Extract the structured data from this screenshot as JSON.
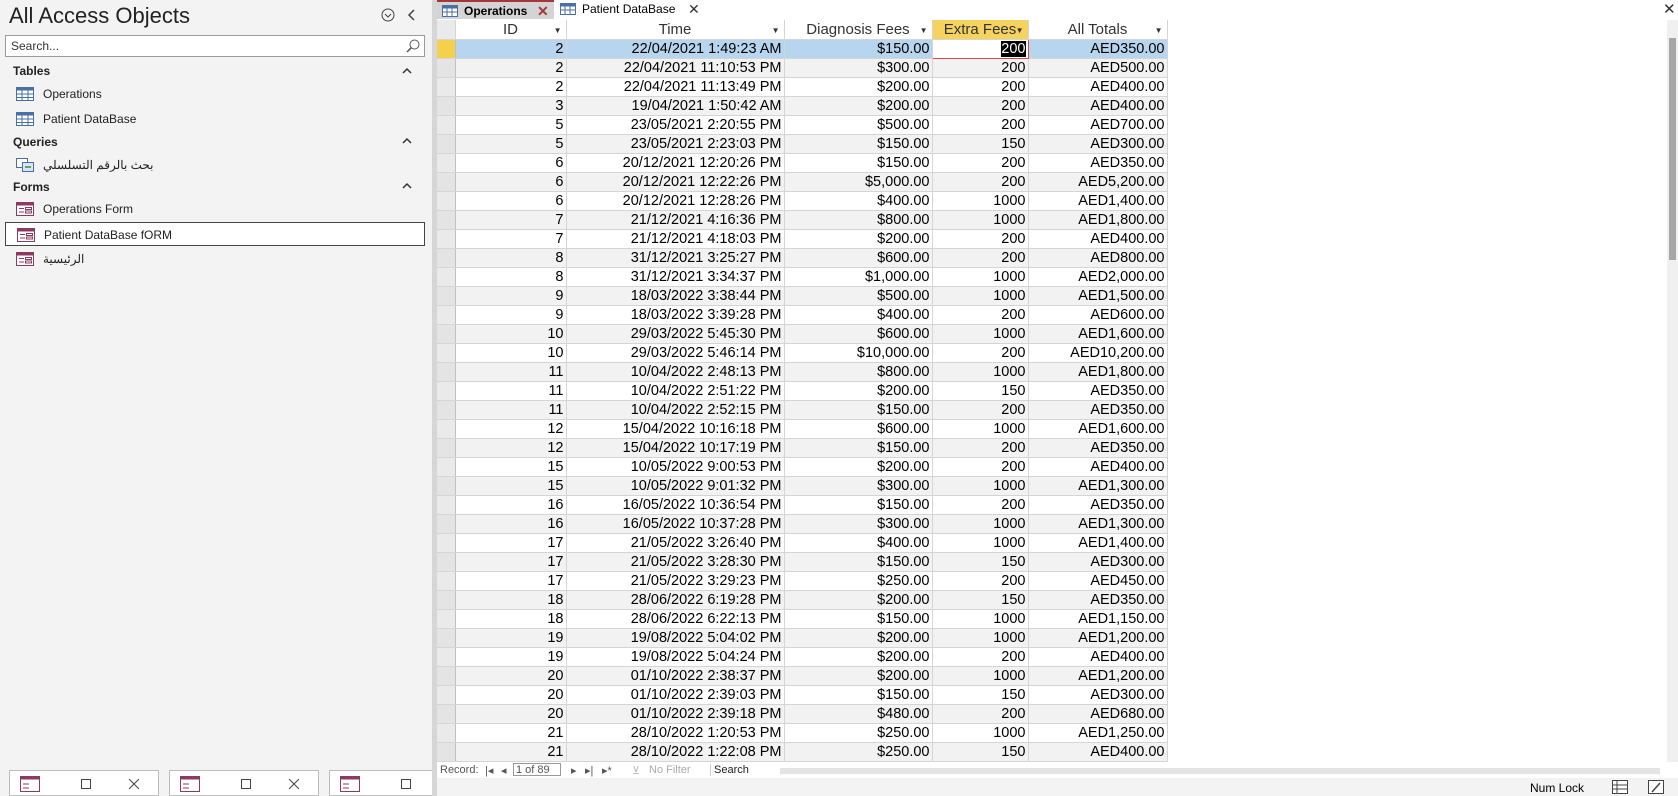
{
  "nav": {
    "title": "All Access Objects",
    "search_placeholder": "Search...",
    "groups": [
      {
        "label": "Tables",
        "items": [
          "Operations",
          "Patient DataBase"
        ]
      },
      {
        "label": "Queries",
        "items": [
          "بحث بالرقم التسلسلي"
        ]
      },
      {
        "label": "Forms",
        "items": [
          "Operations Form",
          "Patient DataBase fORM",
          "الرئيسية"
        ]
      }
    ]
  },
  "tabs": [
    {
      "label": "Operations",
      "active": true
    },
    {
      "label": "Patient DataBase",
      "active": false
    }
  ],
  "columns": [
    "ID",
    "Time",
    "Diagnosis Fees",
    "Extra Fees",
    "All Totals"
  ],
  "rows": [
    [
      "2",
      "22/04/2021 1:49:23 AM",
      "$150.00",
      "200",
      "AED350.00"
    ],
    [
      "2",
      "22/04/2021 11:10:53 PM",
      "$300.00",
      "200",
      "AED500.00"
    ],
    [
      "2",
      "22/04/2021 11:13:49 PM",
      "$200.00",
      "200",
      "AED400.00"
    ],
    [
      "3",
      "19/04/2021 1:50:42 AM",
      "$200.00",
      "200",
      "AED400.00"
    ],
    [
      "5",
      "23/05/2021 2:20:55 PM",
      "$500.00",
      "200",
      "AED700.00"
    ],
    [
      "5",
      "23/05/2021 2:23:03 PM",
      "$150.00",
      "150",
      "AED300.00"
    ],
    [
      "6",
      "20/12/2021 12:20:26 PM",
      "$150.00",
      "200",
      "AED350.00"
    ],
    [
      "6",
      "20/12/2021 12:22:26 PM",
      "$5,000.00",
      "200",
      "AED5,200.00"
    ],
    [
      "6",
      "20/12/2021 12:28:26 PM",
      "$400.00",
      "1000",
      "AED1,400.00"
    ],
    [
      "7",
      "21/12/2021 4:16:36 PM",
      "$800.00",
      "1000",
      "AED1,800.00"
    ],
    [
      "7",
      "21/12/2021 4:18:03 PM",
      "$200.00",
      "200",
      "AED400.00"
    ],
    [
      "8",
      "31/12/2021 3:25:27 PM",
      "$600.00",
      "200",
      "AED800.00"
    ],
    [
      "8",
      "31/12/2021 3:34:37 PM",
      "$1,000.00",
      "1000",
      "AED2,000.00"
    ],
    [
      "9",
      "18/03/2022 3:38:44 PM",
      "$500.00",
      "1000",
      "AED1,500.00"
    ],
    [
      "9",
      "18/03/2022 3:39:28 PM",
      "$400.00",
      "200",
      "AED600.00"
    ],
    [
      "10",
      "29/03/2022 5:45:30 PM",
      "$600.00",
      "1000",
      "AED1,600.00"
    ],
    [
      "10",
      "29/03/2022 5:46:14 PM",
      "$10,000.00",
      "200",
      "AED10,200.00"
    ],
    [
      "11",
      "10/04/2022 2:48:13 PM",
      "$800.00",
      "1000",
      "AED1,800.00"
    ],
    [
      "11",
      "10/04/2022 2:51:22 PM",
      "$200.00",
      "150",
      "AED350.00"
    ],
    [
      "11",
      "10/04/2022 2:52:15 PM",
      "$150.00",
      "200",
      "AED350.00"
    ],
    [
      "12",
      "15/04/2022 10:16:18 PM",
      "$600.00",
      "1000",
      "AED1,600.00"
    ],
    [
      "12",
      "15/04/2022 10:17:19 PM",
      "$150.00",
      "200",
      "AED350.00"
    ],
    [
      "15",
      "10/05/2022 9:00:53 PM",
      "$200.00",
      "200",
      "AED400.00"
    ],
    [
      "15",
      "10/05/2022 9:01:32 PM",
      "$300.00",
      "1000",
      "AED1,300.00"
    ],
    [
      "16",
      "16/05/2022 10:36:54 PM",
      "$150.00",
      "200",
      "AED350.00"
    ],
    [
      "16",
      "16/05/2022 10:37:28 PM",
      "$300.00",
      "1000",
      "AED1,300.00"
    ],
    [
      "17",
      "21/05/2022 3:26:40 PM",
      "$400.00",
      "1000",
      "AED1,400.00"
    ],
    [
      "17",
      "21/05/2022 3:28:30 PM",
      "$150.00",
      "150",
      "AED300.00"
    ],
    [
      "17",
      "21/05/2022 3:29:23 PM",
      "$250.00",
      "200",
      "AED450.00"
    ],
    [
      "18",
      "28/06/2022 6:19:28 PM",
      "$200.00",
      "150",
      "AED350.00"
    ],
    [
      "18",
      "28/06/2022 6:22:13 PM",
      "$150.00",
      "1000",
      "AED1,150.00"
    ],
    [
      "19",
      "19/08/2022 5:04:02 PM",
      "$200.00",
      "1000",
      "AED1,200.00"
    ],
    [
      "19",
      "19/08/2022 5:04:24 PM",
      "$200.00",
      "200",
      "AED400.00"
    ],
    [
      "20",
      "01/10/2022 2:38:37 PM",
      "$200.00",
      "1000",
      "AED1,200.00"
    ],
    [
      "20",
      "01/10/2022 2:39:03 PM",
      "$150.00",
      "150",
      "AED300.00"
    ],
    [
      "20",
      "01/10/2022 2:39:18 PM",
      "$480.00",
      "200",
      "AED680.00"
    ],
    [
      "21",
      "28/10/2022 1:20:53 PM",
      "$250.00",
      "1000",
      "AED1,250.00"
    ],
    [
      "21",
      "28/10/2022 1:22:08 PM",
      "$250.00",
      "150",
      "AED400.00"
    ]
  ],
  "record_nav": {
    "label": "Record:",
    "position": "1 of 89",
    "filter": "No Filter",
    "search": "Search"
  },
  "status": {
    "num_lock": "Num Lock"
  },
  "colors": {
    "accent": "#a4373a",
    "selected_row": "#b7d5ef",
    "selected_header": "#f6d35f"
  }
}
